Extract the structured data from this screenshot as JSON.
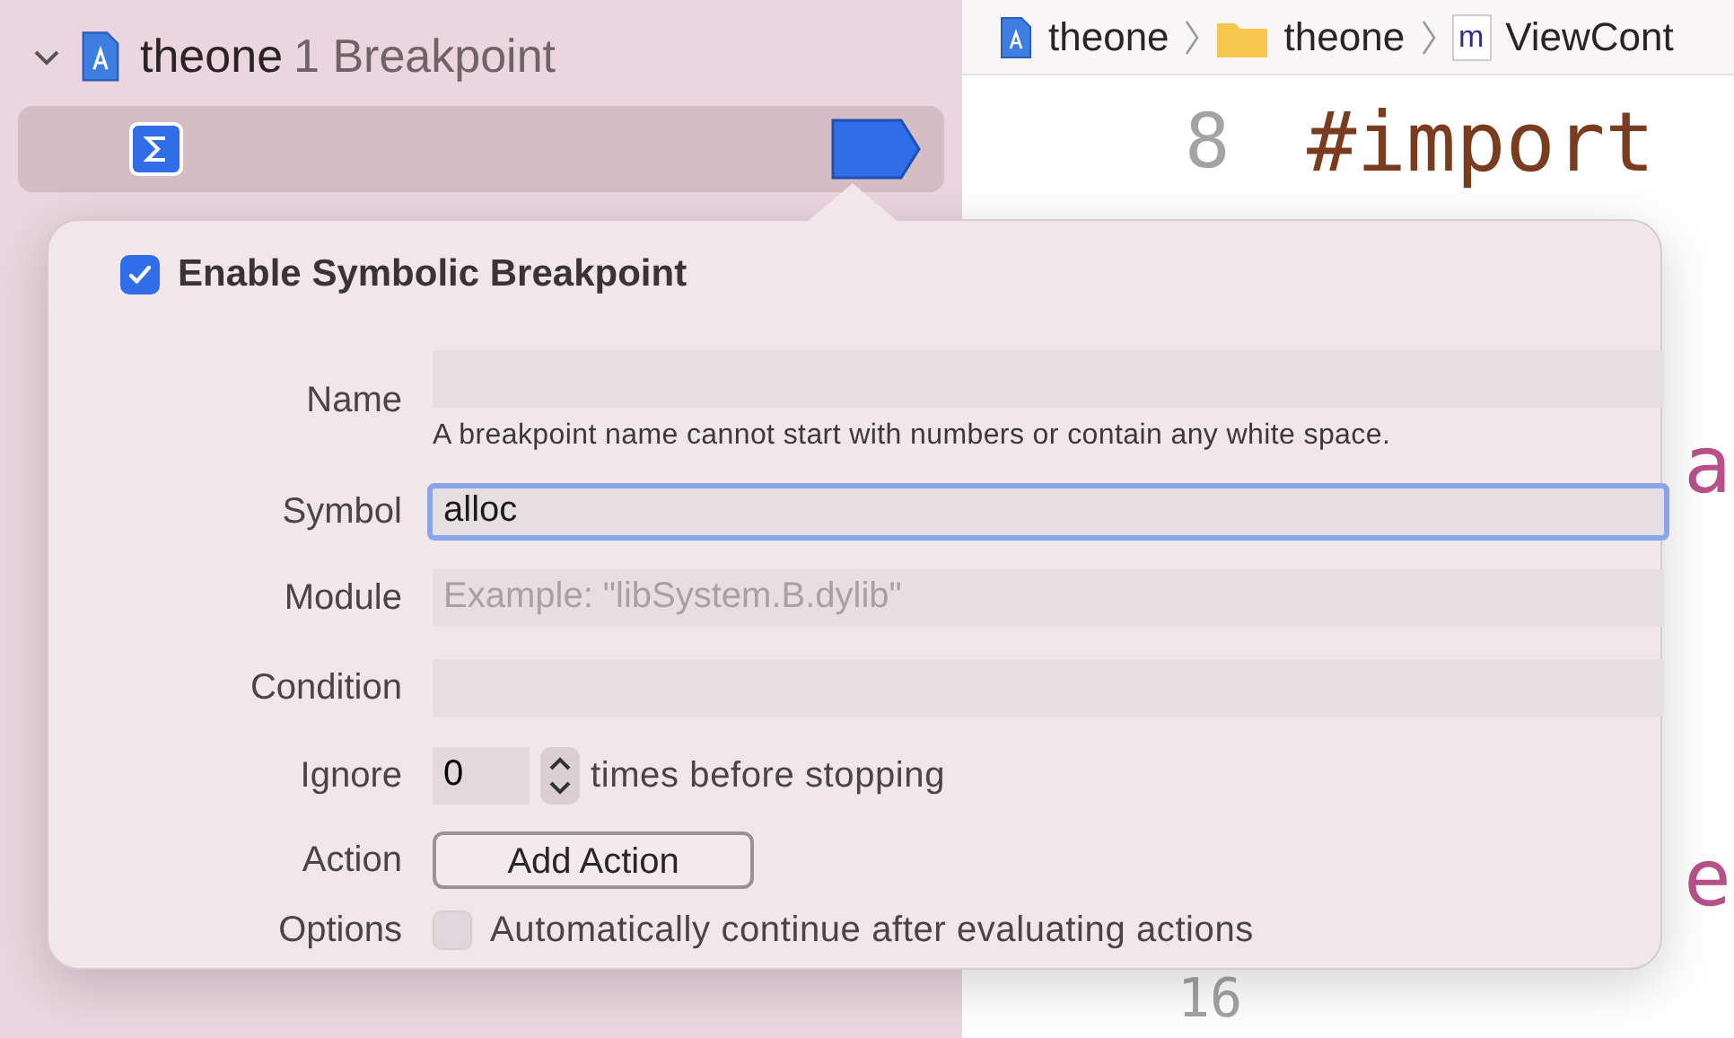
{
  "sidebar": {
    "project": {
      "name": "theone",
      "count": "1 Breakpoint",
      "expanded": true
    },
    "breakpoint": {
      "selected": true,
      "enabled": true
    }
  },
  "breadcrumbs": [
    {
      "kind": "project",
      "label": "theone"
    },
    {
      "kind": "folder",
      "label": "theone"
    },
    {
      "kind": "file",
      "label": "ViewCont",
      "icon_text": "m"
    }
  ],
  "editor": {
    "fragments": [
      {
        "kind": "line_number",
        "text": "8"
      },
      {
        "kind": "directive",
        "text": "#import"
      },
      {
        "kind": "partial",
        "text": "a"
      },
      {
        "kind": "partial",
        "text": "e"
      },
      {
        "kind": "line_number",
        "text": "16"
      }
    ]
  },
  "popover": {
    "enable": {
      "label": "Enable Symbolic Breakpoint",
      "checked": true
    },
    "rows": [
      {
        "kind": "text",
        "label": "Name",
        "note": "A breakpoint name cannot start with numbers or contain any white space."
      },
      {
        "kind": "text",
        "label": "Symbol",
        "value": "alloc",
        "focused": true
      },
      {
        "kind": "text",
        "label": "Module",
        "placeholder": "Example: \"libSystem.B.dylib\""
      },
      {
        "kind": "text",
        "label": "Condition"
      },
      {
        "kind": "stepper",
        "label": "Ignore",
        "value": "0",
        "suffix": "times before stopping"
      },
      {
        "kind": "button",
        "label": "Action",
        "button": "Add Action"
      },
      {
        "kind": "checkbox",
        "label": "Options",
        "text": "Automatically continue after evaluating actions",
        "checked": false
      }
    ]
  }
}
